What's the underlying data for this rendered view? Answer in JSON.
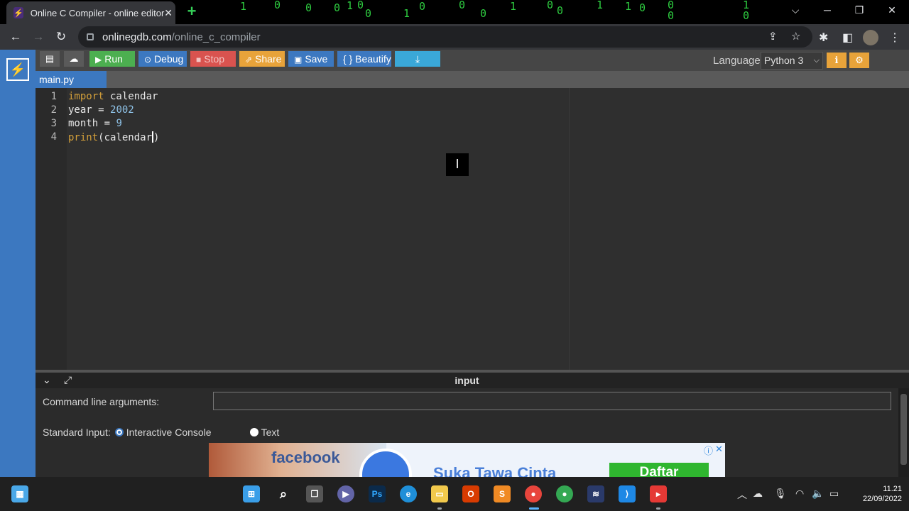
{
  "browser": {
    "tab_title": "Online C Compiler - online editor",
    "tab_close": "✕",
    "new_tab": "+",
    "url_host": "onlinegdb.com",
    "url_path": "/online_c_compiler"
  },
  "ide": {
    "buttons": {
      "run": "Run",
      "debug": "Debug",
      "stop": "Stop",
      "share": "Share",
      "save": "Save",
      "beautify": "{ } Beautify"
    },
    "language_label": "Language",
    "language_value": "Python 3",
    "file_tab": "main.py",
    "code_lines": [
      {
        "n": "1",
        "kw": "import",
        "rest": " calendar"
      },
      {
        "n": "2",
        "kw": "",
        "rest": "year = ",
        "num": "2002"
      },
      {
        "n": "3",
        "kw": "",
        "rest": "month = ",
        "num": "9"
      },
      {
        "n": "4",
        "kw": "print",
        "rest": "(calendar",
        "tail": ")"
      }
    ]
  },
  "io": {
    "title": "input",
    "cla_label": "Command line arguments:",
    "stdin_label": "Standard Input:",
    "opt_interactive": "Interactive Console",
    "opt_text": "Text",
    "selected": "Interactive Console"
  },
  "ad": {
    "brand": "facebook",
    "slogan": "Suka  Tawa  Cinta",
    "cta": "Daftar"
  },
  "taskbar": {
    "time": "11.21",
    "date": "22/09/2022"
  },
  "colors": {
    "run": "#4caf50",
    "debug": "#3c78c0",
    "stop": "#d9534f",
    "share": "#e8a33a",
    "save": "#3c78c0",
    "beautify": "#3c78c0",
    "download": "#3aa8d8"
  }
}
